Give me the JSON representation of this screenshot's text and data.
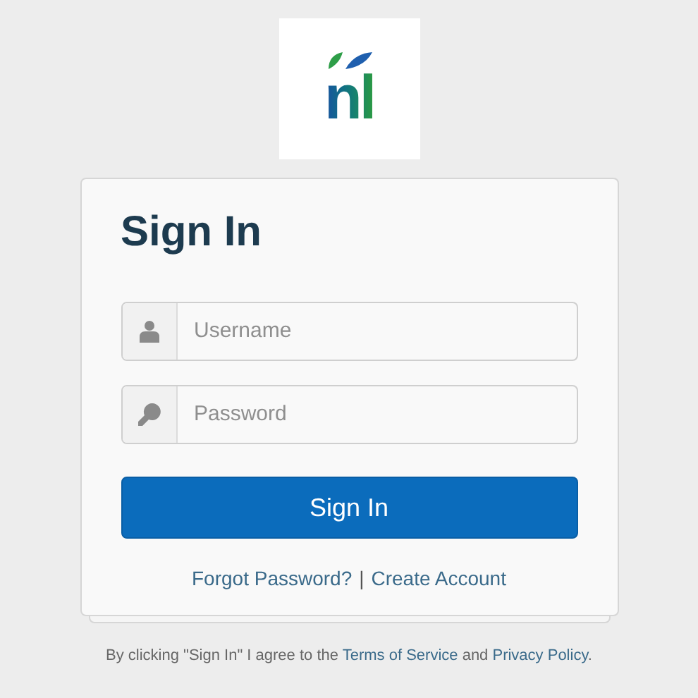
{
  "logo": {
    "text": "nl"
  },
  "title": "Sign In",
  "fields": [
    {
      "kind": "user",
      "placeholder": "Username"
    },
    {
      "kind": "key",
      "placeholder": "Password"
    }
  ],
  "submit": "Sign In",
  "links": [
    "Forgot Password?",
    "Create Account"
  ],
  "separator": "|",
  "footer": {
    "before": "By clicking \"Sign In\" I agree to the ",
    "terms": "Terms of Service",
    "middle": " and ",
    "privacy": "Privacy Policy",
    "after": "."
  }
}
